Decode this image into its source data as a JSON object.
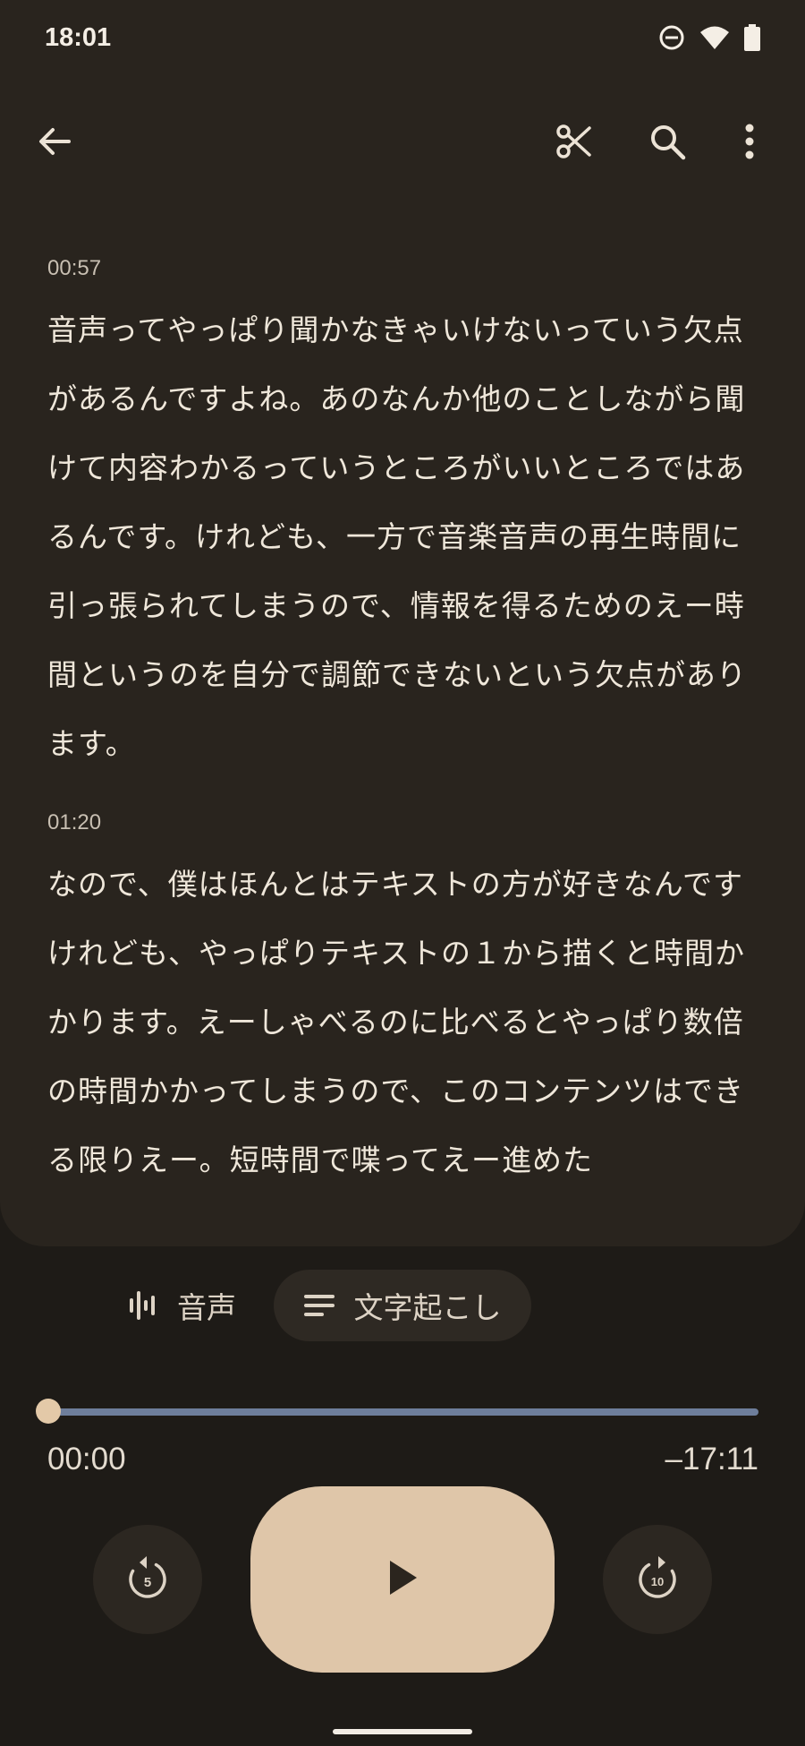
{
  "status_bar": {
    "time": "18:01",
    "icons": [
      "do-not-disturb-icon",
      "wifi-icon",
      "battery-icon"
    ]
  },
  "toolbar": {
    "back_icon": "arrow-back-icon",
    "actions": [
      "scissors-icon",
      "search-icon",
      "more-vert-icon"
    ]
  },
  "transcript": [
    {
      "timestamp": "00:57",
      "text": "音声ってやっぱり聞かなきゃいけないっていう欠点があるんですよね。あのなんか他のことしながら聞けて内容わかるっていうところがいいところではあるんです。けれども、一方で音楽音声の再生時間に引っ張られてしまうので、情報を得るためのえー時間というのを自分で調節できないという欠点があります。"
    },
    {
      "timestamp": "01:20",
      "text": "なので、僕はほんとはテキストの方が好きなんですけれども、やっぱりテキストの１から描くと時間かかります。えーしゃべるのに比べるとやっぱり数倍の時間かかってしまうので、このコンテンツはできる限りえー。短時間で喋ってえー進めた"
    }
  ],
  "tabs": {
    "audio_label": "音声",
    "transcript_label": "文字起こし",
    "selected": "transcript"
  },
  "player": {
    "elapsed": "00:00",
    "remaining": "–17:11",
    "progress": 0.0,
    "rewind_seconds": "5",
    "forward_seconds": "10"
  },
  "colors": {
    "background": "#1e1b17",
    "card": "#29241e",
    "accent": "#dfc6a9",
    "track": "#6e7e9b"
  }
}
